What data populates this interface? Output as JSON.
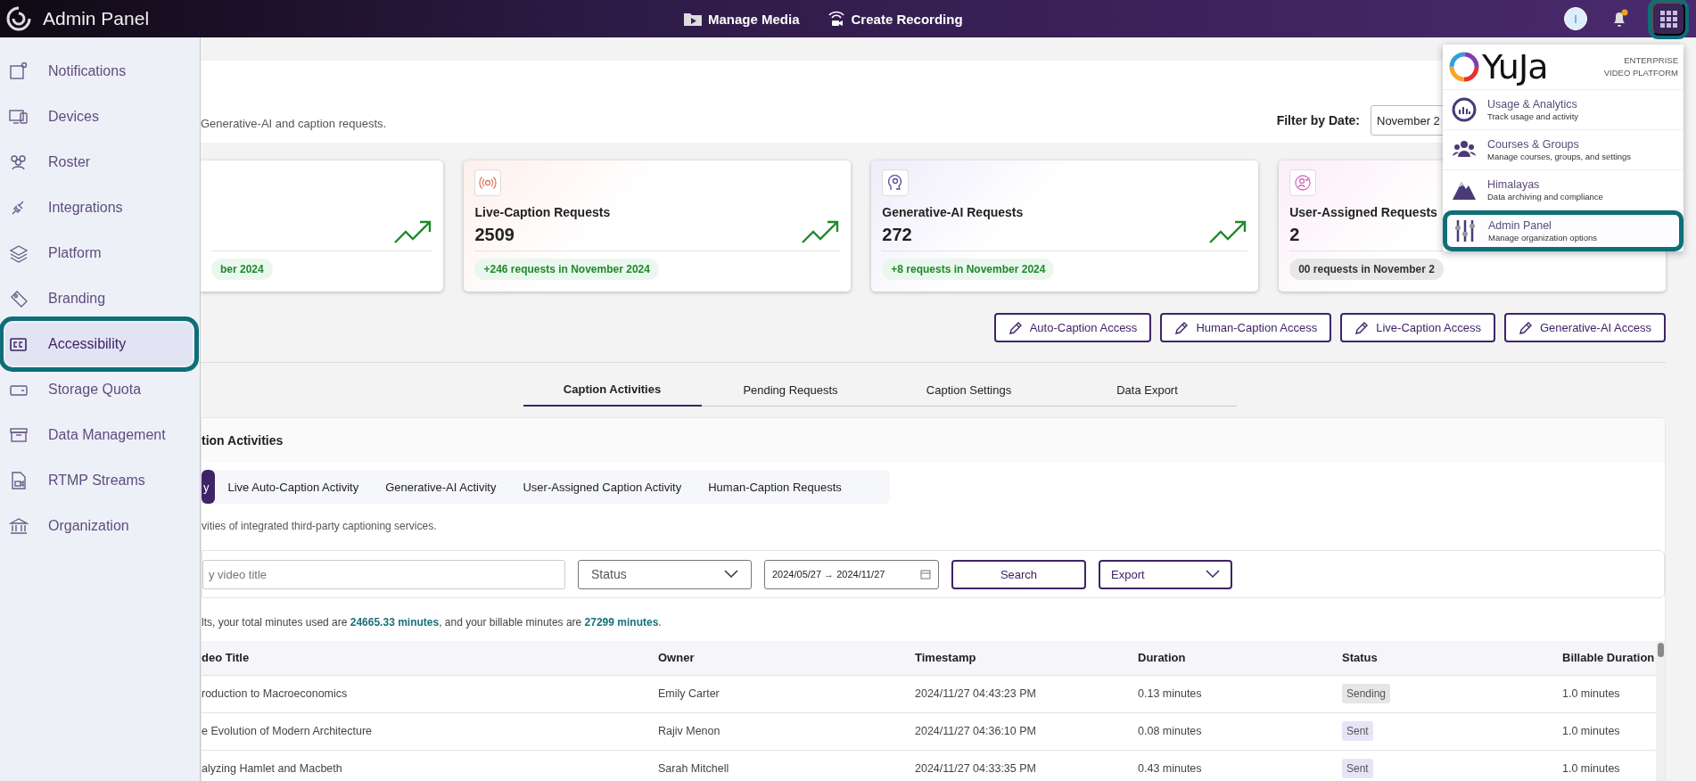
{
  "topbar": {
    "title": "Admin Panel",
    "nav": [
      {
        "kind": "media",
        "label": "Manage Media"
      },
      {
        "kind": "recording",
        "label": "Create Recording"
      }
    ],
    "avatar": "I",
    "apps_highlighted": true
  },
  "sidebar": {
    "items": [
      {
        "kind": "notifications",
        "label": "Notifications",
        "selected": false,
        "highlighted": false
      },
      {
        "kind": "devices",
        "label": "Devices",
        "selected": false,
        "highlighted": false
      },
      {
        "kind": "roster",
        "label": "Roster",
        "selected": false,
        "highlighted": false
      },
      {
        "kind": "integrations",
        "label": "Integrations",
        "selected": false,
        "highlighted": false
      },
      {
        "kind": "platform",
        "label": "Platform",
        "selected": false,
        "highlighted": false
      },
      {
        "kind": "branding",
        "label": "Branding",
        "selected": false,
        "highlighted": false
      },
      {
        "kind": "accessibility",
        "label": "Accessibility",
        "selected": true,
        "highlighted": true
      },
      {
        "kind": "storage",
        "label": "Storage Quota",
        "selected": false,
        "highlighted": false
      },
      {
        "kind": "data",
        "label": "Data Management",
        "selected": false,
        "highlighted": false
      },
      {
        "kind": "rtmp",
        "label": "RTMP Streams",
        "selected": false,
        "highlighted": false
      },
      {
        "kind": "organization",
        "label": "Organization",
        "selected": false,
        "highlighted": false
      }
    ]
  },
  "header": {
    "description": "Generative-AI and caption requests.",
    "filter_label": "Filter by Date:",
    "filter_value": "November 2"
  },
  "stat_cards": [
    {
      "kind": "partial",
      "badge": "ber 2024",
      "rising": true
    },
    {
      "kind": "live",
      "title": "Live-Caption Requests",
      "value": "2509",
      "badge": "+246 requests in November 2024",
      "rising": true
    },
    {
      "kind": "ai",
      "title": "Generative-AI Requests",
      "value": "272",
      "badge": "+8 requests in November 2024",
      "rising": true
    },
    {
      "kind": "user",
      "title": "User-Assigned Requests",
      "value": "2",
      "badge": "00 requests in November 2",
      "rising": false
    }
  ],
  "access_buttons": [
    "Auto-Caption Access",
    "Human-Caption Access",
    "Live-Caption Access",
    "Generative-AI Access"
  ],
  "tabs": [
    {
      "label": "Caption Activities",
      "selected": true
    },
    {
      "label": "Pending Requests",
      "selected": false
    },
    {
      "label": "Caption Settings",
      "selected": false
    },
    {
      "label": "Data Export",
      "selected": false
    }
  ],
  "panel": {
    "title": "tion Activities",
    "subtabs": [
      {
        "label": "y",
        "selected": true
      },
      {
        "label": "Live Auto-Caption Activity",
        "selected": false
      },
      {
        "label": "Generative-AI Activity",
        "selected": false
      },
      {
        "label": "User-Assigned Caption Activity",
        "selected": false
      },
      {
        "label": "Human-Caption Requests",
        "selected": false
      }
    ],
    "description": "vities of integrated third-party captioning services.",
    "filters": {
      "search_placeholder": "y video title",
      "status_placeholder": "Status",
      "date_range": "2024/05/27 → 2024/11/27",
      "search_button": "Search",
      "export_label": "Export"
    },
    "summary": "lts, your total minutes used are **24665.33 minutes**, and your billable minutes are **27299 minutes**.",
    "table": {
      "columns": [
        "deo Title",
        "Owner",
        "Timestamp",
        "Duration",
        "Status",
        "Billable Duration"
      ],
      "rows": [
        {
          "title": "roduction to Macroeconomics",
          "owner": "Emily Carter",
          "timestamp": "2024/11/27 04:43:23 PM",
          "duration": "0.13 minutes",
          "status": "Sending",
          "kind": "pending",
          "billable": "1.0 minutes"
        },
        {
          "title": "e Evolution of Modern Architecture",
          "owner": "Rajiv Menon",
          "timestamp": "2024/11/27 04:36:10 PM",
          "duration": "0.08 minutes",
          "status": "Sent",
          "kind": "done",
          "billable": "1.0 minutes"
        },
        {
          "title": "alyzing Hamlet and Macbeth",
          "owner": "Sarah Mitchell",
          "timestamp": "2024/11/27 04:33:35 PM",
          "duration": "0.43 minutes",
          "status": "Sent",
          "kind": "done",
          "billable": "1.0 minutes"
        }
      ]
    }
  },
  "apps_menu": {
    "brand": "YuJa",
    "tagline": "ENTERPRISE VIDEO PLATFORM",
    "items": [
      {
        "kind": "analytics",
        "title": "Usage & Analytics",
        "subtitle": "Track usage and activity",
        "highlighted": false
      },
      {
        "kind": "courses",
        "title": "Courses & Groups",
        "subtitle": "Manage courses, groups, and settings",
        "highlighted": false
      },
      {
        "kind": "himalayas",
        "title": "Himalayas",
        "subtitle": "Data archiving and compliance",
        "highlighted": false
      },
      {
        "kind": "admin",
        "title": "Admin Panel",
        "subtitle": "Manage organization options",
        "highlighted": true
      }
    ]
  }
}
